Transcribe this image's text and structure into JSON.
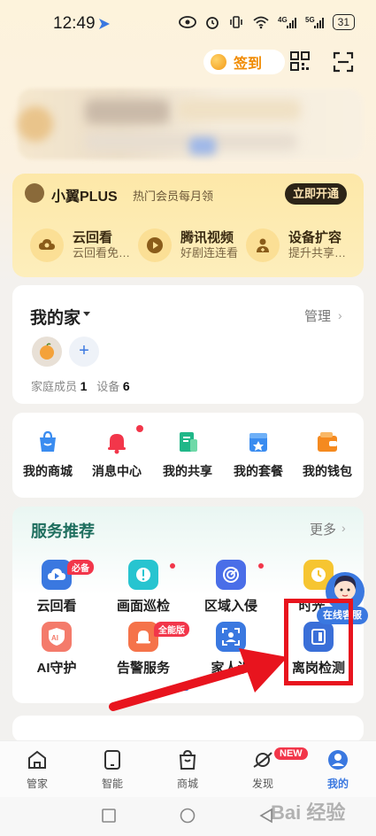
{
  "status_bar": {
    "time": "12:49",
    "battery": "31",
    "icons": [
      "eye-icon",
      "alarm-icon",
      "vibrate-icon",
      "wifi-icon",
      "4g-signal-icon",
      "5g-signal-icon",
      "battery-icon"
    ]
  },
  "header": {
    "signin_label": "签到",
    "icons": [
      "qr-code-icon",
      "scan-icon"
    ]
  },
  "plus": {
    "title": "小翼PLUS",
    "subtitle": "热门会员每月领",
    "open_button": "立即开通",
    "perks": [
      {
        "title": "云回看",
        "subtitle": "云回看免…",
        "icon": "cloud-replay-icon"
      },
      {
        "title": "腾讯视频",
        "subtitle": "好剧连连看",
        "icon": "video-play-icon"
      },
      {
        "title": "设备扩容",
        "subtitle": "提升共享…",
        "icon": "expand-device-icon"
      }
    ]
  },
  "family": {
    "title": "我的家",
    "manage": "管理",
    "members_label": "家庭成员",
    "members_count": "1",
    "devices_label": "设备",
    "devices_count": "6"
  },
  "quick": {
    "items": [
      {
        "label": "我的商城",
        "icon": "shopping-bag-icon"
      },
      {
        "label": "消息中心",
        "icon": "bell-icon"
      },
      {
        "label": "我的共享",
        "icon": "share-icon"
      },
      {
        "label": "我的套餐",
        "icon": "package-icon"
      },
      {
        "label": "我的钱包",
        "icon": "wallet-icon"
      }
    ]
  },
  "services": {
    "title": "服务推荐",
    "more": "更多",
    "row1": [
      {
        "label": "云回看",
        "tag": "必备",
        "icon": "cloud-replay-icon"
      },
      {
        "label": "画面巡检",
        "icon": "inspection-icon"
      },
      {
        "label": "区域入侵",
        "icon": "area-intrusion-icon"
      },
      {
        "label": "时光…",
        "icon": "time-icon"
      }
    ],
    "row2": [
      {
        "label": "AI守护",
        "icon": "ai-guard-icon"
      },
      {
        "label": "告警服务",
        "tag": "全能版",
        "icon": "alarm-service-icon"
      },
      {
        "label": "家人识",
        "icon": "face-recognition-icon"
      },
      {
        "label": "离岗检测",
        "icon": "absence-detection-icon"
      }
    ],
    "online_service": "在线客服"
  },
  "bottom_nav": [
    {
      "label": "管家",
      "icon": "home-icon"
    },
    {
      "label": "智能",
      "icon": "tablet-icon"
    },
    {
      "label": "商城",
      "icon": "shopping-bag-icon"
    },
    {
      "label": "发现",
      "icon": "planet-icon",
      "badge": "NEW"
    },
    {
      "label": "我的",
      "icon": "user-icon",
      "active": true
    }
  ],
  "watermark": "Bai 经验",
  "colors": {
    "accent": "#3a78e0",
    "badge": "#f2364a",
    "highlight": "#e8141e",
    "gold": "#f08a00"
  }
}
